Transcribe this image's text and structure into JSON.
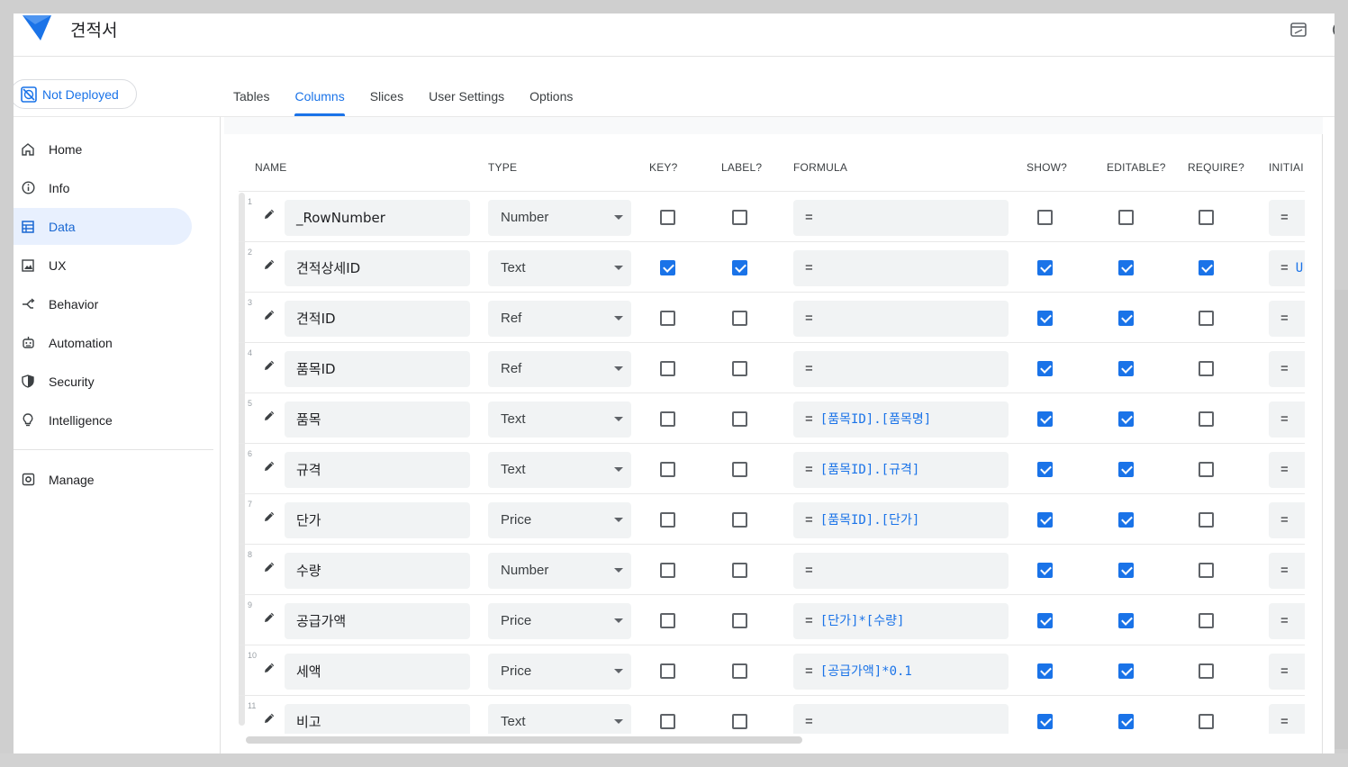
{
  "app": {
    "title": "견적서"
  },
  "deploy": {
    "label": "Not Deployed"
  },
  "tabs": [
    {
      "label": "Tables",
      "active": false
    },
    {
      "label": "Columns",
      "active": true
    },
    {
      "label": "Slices",
      "active": false
    },
    {
      "label": "User Settings",
      "active": false
    },
    {
      "label": "Options",
      "active": false
    }
  ],
  "sidebar": {
    "items": [
      {
        "label": "Home",
        "icon": "home-icon"
      },
      {
        "label": "Info",
        "icon": "info-icon"
      },
      {
        "label": "Data",
        "icon": "table-icon",
        "active": true
      },
      {
        "label": "UX",
        "icon": "image-icon"
      },
      {
        "label": "Behavior",
        "icon": "branch-icon"
      },
      {
        "label": "Automation",
        "icon": "robot-icon"
      },
      {
        "label": "Security",
        "icon": "shield-icon"
      },
      {
        "label": "Intelligence",
        "icon": "lightbulb-icon"
      }
    ],
    "manage": {
      "label": "Manage",
      "icon": "gear-icon"
    }
  },
  "columns": {
    "headers": {
      "name": "NAME",
      "type": "TYPE",
      "key": "KEY?",
      "label": "LABEL?",
      "formula": "FORMULA",
      "show": "SHOW?",
      "editable": "EDITABLE?",
      "require": "REQUIRE?",
      "initial": "INITIAI"
    },
    "rows": [
      {
        "num": "1",
        "name": "_RowNumber",
        "type": "Number",
        "key": false,
        "label": false,
        "formula_prefix": "=",
        "formula": "",
        "show": false,
        "editable": false,
        "require": false,
        "initial_prefix": "=",
        "initial": ""
      },
      {
        "num": "2",
        "name": "견적상세ID",
        "type": "Text",
        "key": true,
        "label": true,
        "formula_prefix": "=",
        "formula": "",
        "show": true,
        "editable": true,
        "require": true,
        "initial_prefix": "=",
        "initial": "U"
      },
      {
        "num": "3",
        "name": "견적ID",
        "type": "Ref",
        "key": false,
        "label": false,
        "formula_prefix": "=",
        "formula": "",
        "show": true,
        "editable": true,
        "require": false,
        "initial_prefix": "=",
        "initial": ""
      },
      {
        "num": "4",
        "name": "품목ID",
        "type": "Ref",
        "key": false,
        "label": false,
        "formula_prefix": "=",
        "formula": "",
        "show": true,
        "editable": true,
        "require": false,
        "initial_prefix": "=",
        "initial": ""
      },
      {
        "num": "5",
        "name": "품목",
        "type": "Text",
        "key": false,
        "label": false,
        "formula_prefix": "=",
        "formula": "[품목ID].[품목명]",
        "show": true,
        "editable": true,
        "require": false,
        "initial_prefix": "=",
        "initial": ""
      },
      {
        "num": "6",
        "name": "규격",
        "type": "Text",
        "key": false,
        "label": false,
        "formula_prefix": "=",
        "formula": "[품목ID].[규격]",
        "show": true,
        "editable": true,
        "require": false,
        "initial_prefix": "=",
        "initial": ""
      },
      {
        "num": "7",
        "name": "단가",
        "type": "Price",
        "key": false,
        "label": false,
        "formula_prefix": "=",
        "formula": "[품목ID].[단가]",
        "show": true,
        "editable": true,
        "require": false,
        "initial_prefix": "=",
        "initial": ""
      },
      {
        "num": "8",
        "name": "수량",
        "type": "Number",
        "key": false,
        "label": false,
        "formula_prefix": "=",
        "formula": "",
        "show": true,
        "editable": true,
        "require": false,
        "initial_prefix": "=",
        "initial": ""
      },
      {
        "num": "9",
        "name": "공급가액",
        "type": "Price",
        "key": false,
        "label": false,
        "formula_prefix": "=",
        "formula": "[단가]*[수량]",
        "show": true,
        "editable": true,
        "require": false,
        "initial_prefix": "=",
        "initial": ""
      },
      {
        "num": "10",
        "name": "세액",
        "type": "Price",
        "key": false,
        "label": false,
        "formula_prefix": "=",
        "formula": "[공급가액]*0.1",
        "show": true,
        "editable": true,
        "require": false,
        "initial_prefix": "=",
        "initial": ""
      },
      {
        "num": "11",
        "name": "비고",
        "type": "Text",
        "key": false,
        "label": false,
        "formula_prefix": "=",
        "formula": "",
        "show": true,
        "editable": true,
        "require": false,
        "initial_prefix": "=",
        "initial": ""
      }
    ]
  },
  "colors": {
    "accent": "#1a73e8",
    "active_nav_bg": "#e8f0fe",
    "field_bg": "#f1f3f4"
  }
}
